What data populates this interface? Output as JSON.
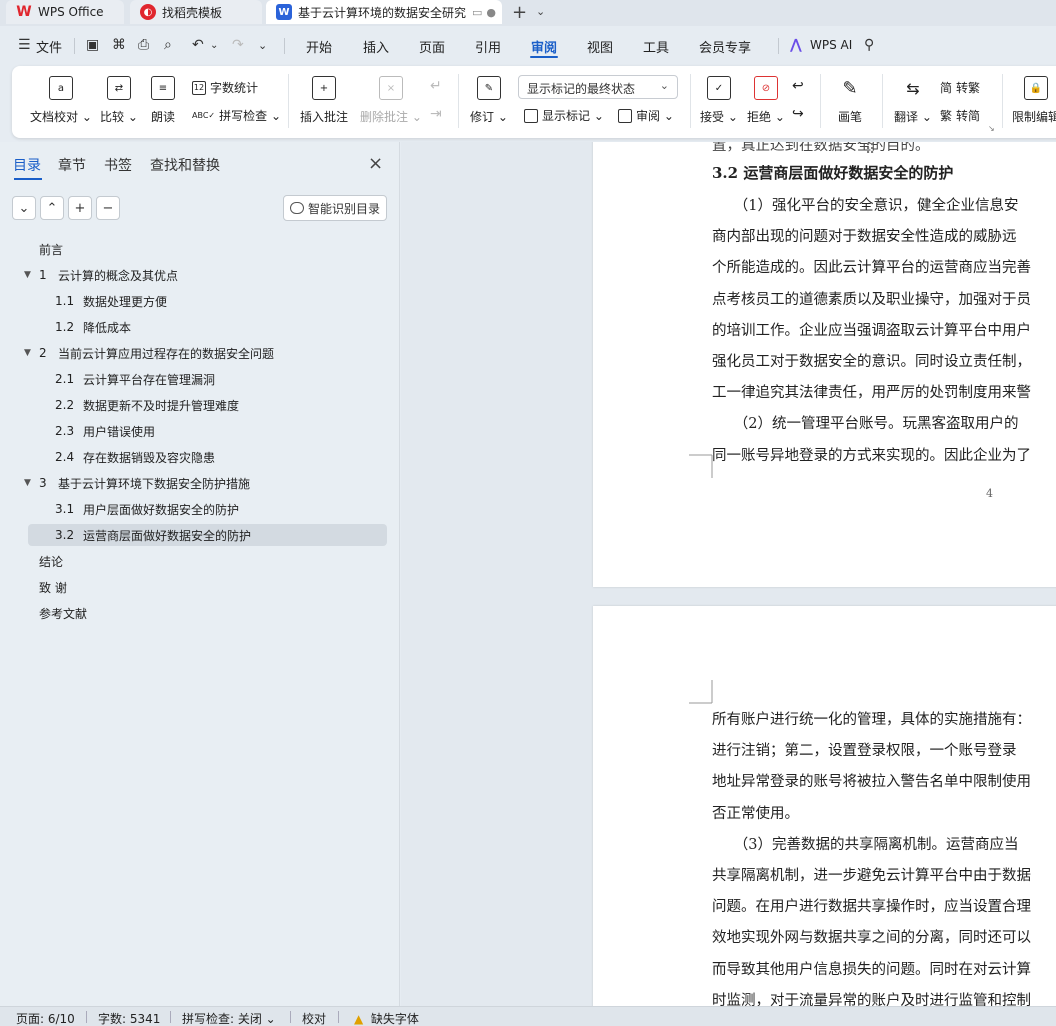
{
  "tabs": {
    "wps": "WPS Office",
    "templates": "找稻壳模板",
    "document": "基于云计算环境的数据安全研究"
  },
  "menu": {
    "file": "文件",
    "items": [
      "开始",
      "插入",
      "页面",
      "引用",
      "审阅",
      "视图",
      "工具",
      "会员专享"
    ],
    "ai": "WPS AI"
  },
  "ribbon": {
    "doc_check": "文档校对",
    "compare": "比较",
    "read_aloud": "朗读",
    "word_count": "字数统计",
    "spell_check": "拼写检查",
    "insert_comment": "插入批注",
    "delete_comment": "删除批注",
    "track_changes": "修订",
    "markup_state": "显示标记的最终状态",
    "show_markup": "显示标记",
    "review": "审阅",
    "accept": "接受",
    "reject": "拒绝",
    "pen": "画笔",
    "translate": "翻译",
    "to_traditional": "转繁",
    "to_simplified": "转简",
    "restrict_edit": "限制编辑"
  },
  "panel": {
    "tabs": [
      "目录",
      "章节",
      "书签",
      "查找和替换"
    ],
    "smart_toc": "智能识别目录",
    "toc": [
      {
        "num": "",
        "title": "前言"
      },
      {
        "num": "1",
        "title": "云计算的概念及其优点"
      },
      {
        "num": "1.1",
        "title": "数据处理更方便"
      },
      {
        "num": "1.2",
        "title": "降低成本"
      },
      {
        "num": "2",
        "title": "当前云计算应用过程存在的数据安全问题"
      },
      {
        "num": "2.1",
        "title": "云计算平台存在管理漏洞"
      },
      {
        "num": "2.2",
        "title": "数据更新不及时提升管理难度"
      },
      {
        "num": "2.3",
        "title": "用户错误使用"
      },
      {
        "num": "2.4",
        "title": "存在数据销毁及容灾隐患"
      },
      {
        "num": "3",
        "title": "基于云计算环境下数据安全防护措施"
      },
      {
        "num": "3.1",
        "title": "用户层面做好数据安全的防护"
      },
      {
        "num": "3.2",
        "title": "运营商层面做好数据安全的防护"
      },
      {
        "num": "",
        "title": "结论"
      },
      {
        "num": "",
        "title": "致 谢"
      },
      {
        "num": "",
        "title": "参考文献"
      }
    ]
  },
  "document": {
    "page1": {
      "top_line": "置，真正达到在数据安全的目的。",
      "heading": "3.2  运营商层面做好数据安全的防护",
      "lines": [
        "　　（1）强化平台的安全意识，健全企业信息安",
        "商内部出现的问题对于数据安全性造成的威胁远",
        "个所能造成的。因此云计算平台的运营商应当完善",
        "点考核员工的道德素质以及职业操守，加强对于员",
        "的培训工作。企业应当强调盗取云计算平台中用户",
        "强化员工对于数据安全的意识。同时设立责任制，",
        "工一律追究其法律责任，用严厉的处罚制度用来警",
        "　　（2）统一管理平台账号。玩黑客盗取用户的",
        "同一账号异地登录的方式来实现的。因此企业为了"
      ],
      "page_number": "4"
    },
    "page2": {
      "lines": [
        "所有账户进行统一化的管理，具体的实施措施有：",
        "进行注销；第二，设置登录权限，一个账号登录",
        "地址异常登录的账号将被拉入警告名单中限制使用",
        "否正常使用。",
        "　　（3）完善数据的共享隔离机制。运营商应当",
        "共享隔离机制，进一步避免云计算平台中由于数据",
        "问题。在用户进行数据共享操作时，应当设置合理",
        "效地实现外网与数据共享之间的分离，同时还可以",
        "而导致其他用户信息损失的问题。同时在对云计算",
        "时监测，对于流量异常的账户及时进行监管和控制"
      ]
    }
  },
  "status": {
    "page": "页面: 6/10",
    "words": "字数: 5341",
    "spell": "拼写检查: 关闭",
    "proof": "校对",
    "missing_font": "缺失字体"
  }
}
